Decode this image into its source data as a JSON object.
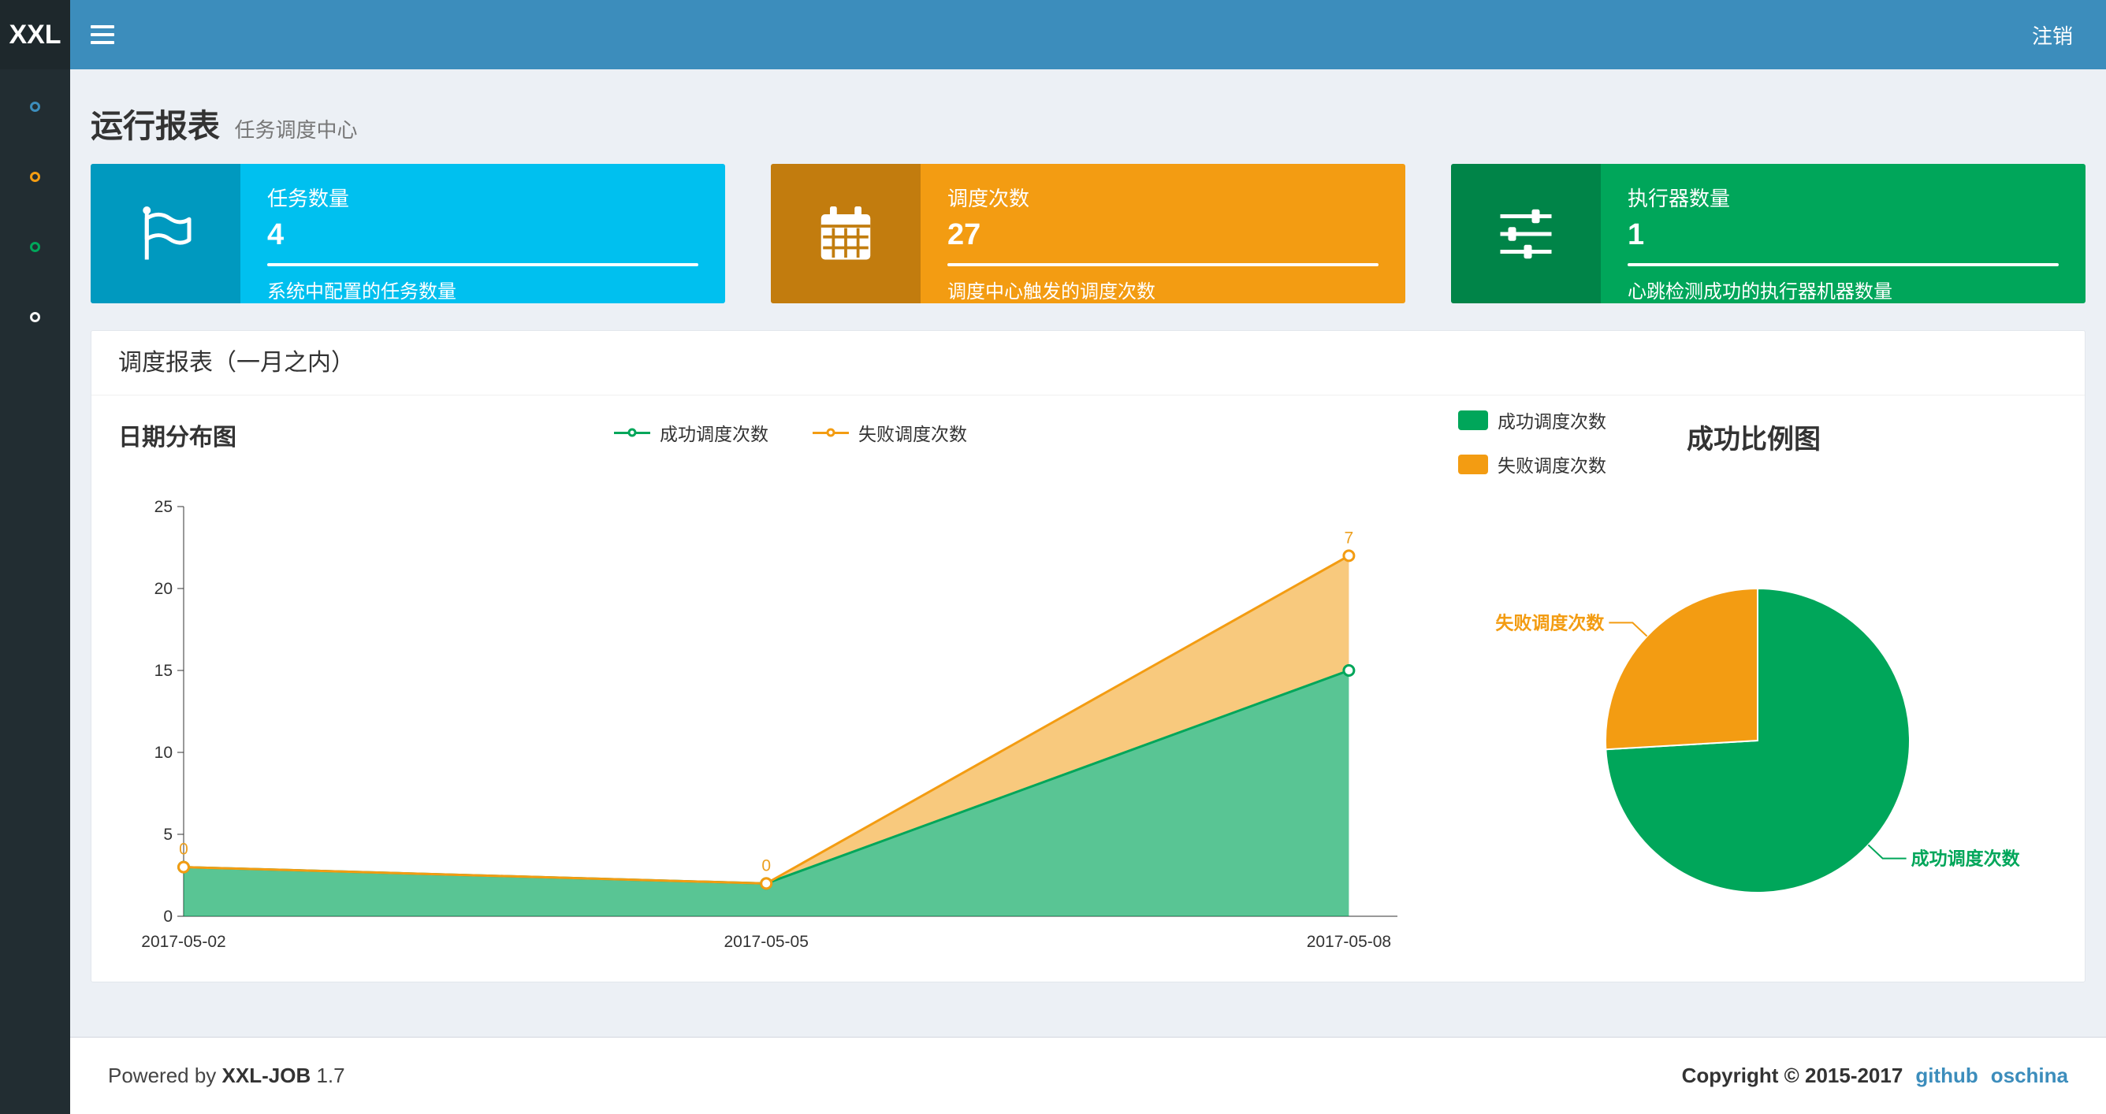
{
  "navbar": {
    "logo": "XXL",
    "logout_label": "注销"
  },
  "sidebar": {
    "items": [
      {
        "name": "menu-item-1",
        "color": "#3c8dbc"
      },
      {
        "name": "menu-item-2",
        "color": "#f39c12"
      },
      {
        "name": "menu-item-3",
        "color": "#00a65a"
      },
      {
        "name": "menu-item-4",
        "color": "#ffffff"
      }
    ]
  },
  "page_header": {
    "title": "运行报表",
    "subtitle": "任务调度中心"
  },
  "info_boxes": [
    {
      "icon": "flag-icon",
      "label": "任务数量",
      "value": "4",
      "description": "系统中配置的任务数量",
      "color": "#00c0ef"
    },
    {
      "icon": "calendar-icon",
      "label": "调度次数",
      "value": "27",
      "description": "调度中心触发的调度次数",
      "color": "#f39c12"
    },
    {
      "icon": "sliders-icon",
      "label": "执行器数量",
      "value": "1",
      "description": "心跳检测成功的执行器机器数量",
      "color": "#00a65a"
    }
  ],
  "panel": {
    "title": "调度报表（一月之内）"
  },
  "chart_data": [
    {
      "type": "area",
      "title": "日期分布图",
      "x": [
        "2017-05-02",
        "2017-05-05",
        "2017-05-08"
      ],
      "series": [
        {
          "name": "成功调度次数",
          "values": [
            3,
            2,
            15
          ],
          "color": "#00a65a"
        },
        {
          "name": "失败调度次数",
          "values": [
            0,
            0,
            7
          ],
          "color": "#f39c12",
          "stacked": true
        }
      ],
      "point_labels": {
        "series": "失败调度次数",
        "values": [
          "0",
          "0",
          "7"
        ]
      },
      "ylim": [
        0,
        25
      ],
      "yticks": [
        0,
        5,
        10,
        15,
        20,
        25
      ],
      "legend": [
        "成功调度次数",
        "失败调度次数"
      ],
      "legend_position": "top",
      "grid": false
    },
    {
      "type": "pie",
      "title": "成功比例图",
      "slices": [
        {
          "label": "成功调度次数",
          "value": 20,
          "color": "#00a65a"
        },
        {
          "label": "失败调度次数",
          "value": 7,
          "color": "#f39c12"
        }
      ],
      "legend": [
        "成功调度次数",
        "失败调度次数"
      ],
      "legend_position": "top-left"
    }
  ],
  "footer": {
    "powered_prefix": "Powered by ",
    "product": "XXL-JOB",
    "version": " 1.7",
    "copyright": "Copyright © 2015-2017",
    "links": [
      "github",
      "oschina"
    ]
  }
}
